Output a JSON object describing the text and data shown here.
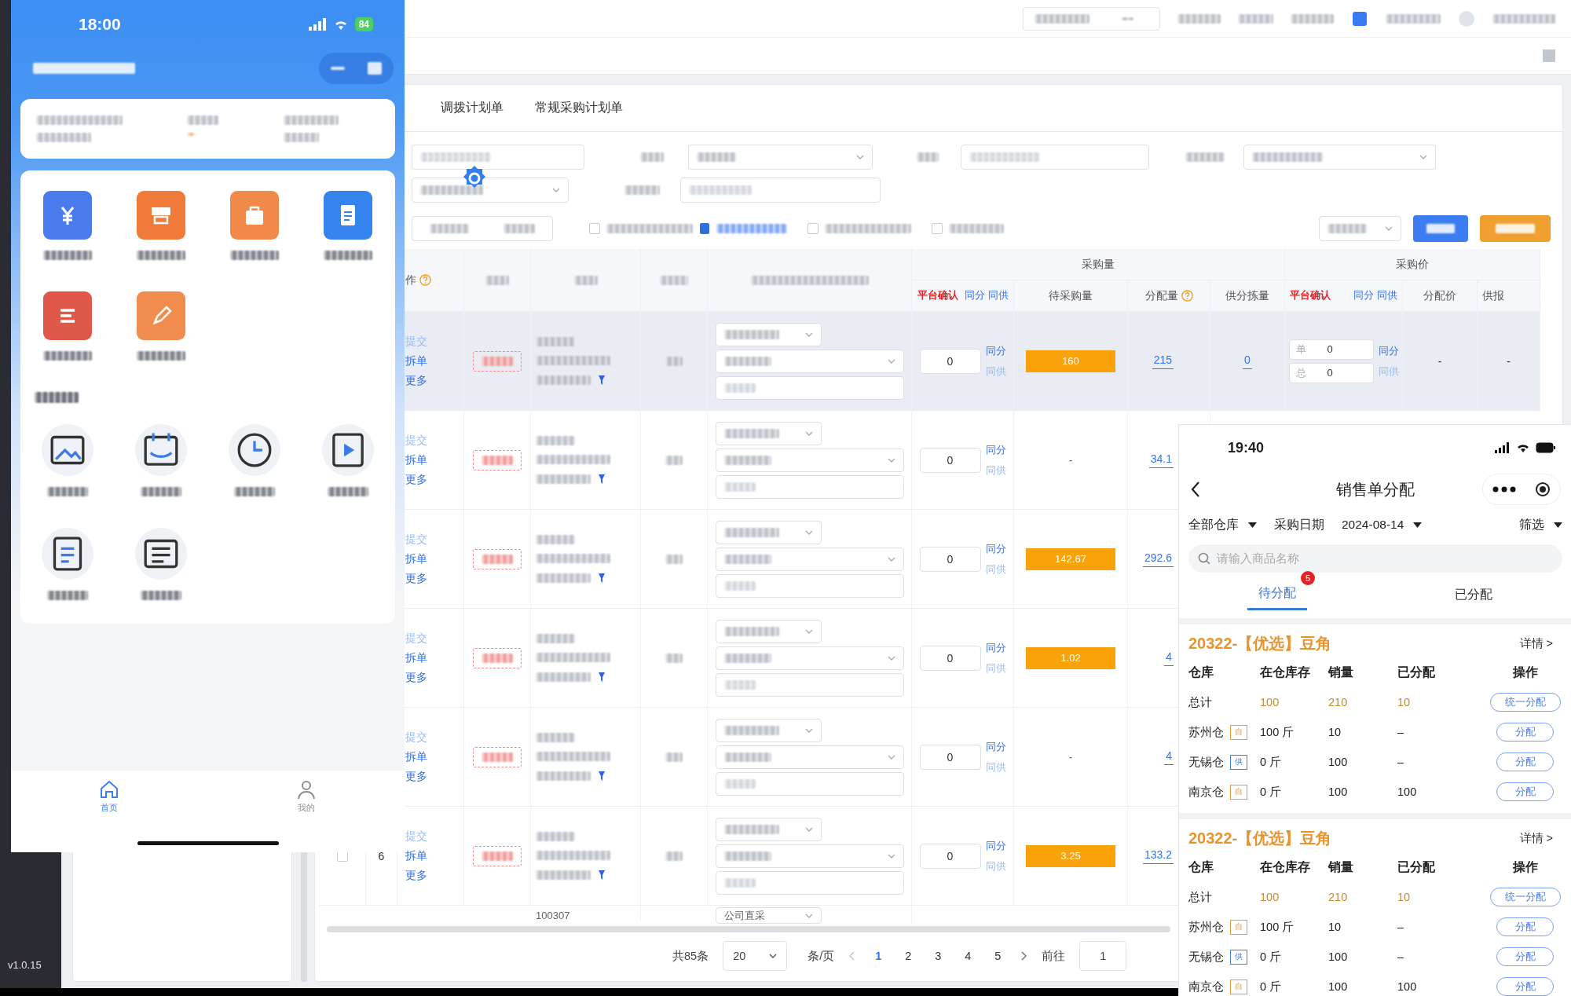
{
  "desktop_app": {
    "version": "v1.0.15",
    "tabs": [
      {
        "label": "调拨计划单"
      },
      {
        "label": "常规采购计划单"
      }
    ],
    "toolbar_checkboxes": [
      {
        "checked": false
      },
      {
        "checked": false
      },
      {
        "checked": false
      }
    ],
    "table": {
      "group_headers": [
        {
          "label": "采购量"
        },
        {
          "label": "采购价"
        }
      ],
      "headers": {
        "operations": "作",
        "qty_confirm": "平台确认",
        "qty_links": [
          "同分",
          "同供"
        ],
        "pending_qty": "待采购量",
        "allocated_qty": "分配量",
        "sorting_qty": "供分拣量",
        "price_confirm": "平台确认",
        "price_links": [
          "同分",
          "同供"
        ],
        "allocated_price": "分配价",
        "supplier_price": "供报"
      },
      "rows": [
        {
          "hovered": true,
          "actions": [
            {
              "label": "提交",
              "disabled": true
            },
            {
              "label": "拆单",
              "disabled": false
            },
            {
              "label": "更多",
              "disabled": false
            }
          ],
          "qty_input": "0",
          "links": [
            {
              "label": "同分",
              "disabled": false
            },
            {
              "label": "同供",
              "disabled": true
            }
          ],
          "pending_qty": "160",
          "pending_highlight": true,
          "allocated_qty": "215",
          "sorting_qty": "0",
          "price_inputs": [
            {
              "label": "单",
              "value": "0"
            },
            {
              "label": "总",
              "value": "0"
            }
          ],
          "price_links": [
            {
              "label": "同分",
              "disabled": false
            },
            {
              "label": "同供",
              "disabled": true
            }
          ],
          "allocated_price": "-",
          "supplier_price": "-"
        },
        {
          "hovered": false,
          "actions": [
            {
              "label": "提交",
              "disabled": true
            },
            {
              "label": "拆单",
              "disabled": false
            },
            {
              "label": "更多",
              "disabled": false
            }
          ],
          "qty_input": "0",
          "links": [
            {
              "label": "同分",
              "disabled": false
            },
            {
              "label": "同供",
              "disabled": true
            }
          ],
          "pending_qty": "-",
          "pending_highlight": false,
          "allocated_qty": "34.1"
        },
        {
          "hovered": false,
          "actions": [
            {
              "label": "提交",
              "disabled": true
            },
            {
              "label": "拆单",
              "disabled": false
            },
            {
              "label": "更多",
              "disabled": false
            }
          ],
          "qty_input": "0",
          "links": [
            {
              "label": "同分",
              "disabled": false
            },
            {
              "label": "同供",
              "disabled": true
            }
          ],
          "pending_qty": "142.67",
          "pending_highlight": true,
          "allocated_qty": "292.6"
        },
        {
          "hovered": false,
          "actions": [
            {
              "label": "提交",
              "disabled": true
            },
            {
              "label": "拆单",
              "disabled": false
            },
            {
              "label": "更多",
              "disabled": false
            }
          ],
          "qty_input": "0",
          "links": [
            {
              "label": "同分",
              "disabled": false
            },
            {
              "label": "同供",
              "disabled": true
            }
          ],
          "pending_qty": "1.02",
          "pending_highlight": true,
          "allocated_qty": "4"
        },
        {
          "hovered": false,
          "actions": [
            {
              "label": "提交",
              "disabled": true
            },
            {
              "label": "拆单",
              "disabled": false
            },
            {
              "label": "更多",
              "disabled": false
            }
          ],
          "qty_input": "0",
          "links": [
            {
              "label": "同分",
              "disabled": false
            },
            {
              "label": "同供",
              "disabled": true
            }
          ],
          "pending_qty": "-",
          "pending_highlight": false,
          "allocated_qty": "4"
        },
        {
          "hovered": false,
          "checked": false,
          "index": "6",
          "actions": [
            {
              "label": "提交",
              "disabled": true
            },
            {
              "label": "拆单",
              "disabled": false
            },
            {
              "label": "更多",
              "disabled": false
            }
          ],
          "qty_input": "0",
          "links": [
            {
              "label": "同分",
              "disabled": false
            },
            {
              "label": "同供",
              "disabled": true
            }
          ],
          "pending_qty": "3.25",
          "pending_highlight": true,
          "allocated_qty": "133.2"
        }
      ],
      "partial_row": {
        "product_code": "100307",
        "source": "公司直采"
      }
    },
    "pagination": {
      "total": "共85条",
      "page_size": "20",
      "per_page": "条/页",
      "pages": [
        {
          "label": "1",
          "selected": true
        },
        {
          "label": "2",
          "selected": false
        },
        {
          "label": "3",
          "selected": false
        },
        {
          "label": "4",
          "selected": false
        },
        {
          "label": "5",
          "selected": false
        }
      ],
      "goto": "前往",
      "goto_value": "1"
    }
  },
  "left_phone": {
    "status_time": "18:00",
    "battery": "84",
    "shortcuts": [
      {
        "kind": "yen",
        "color": "#4a7bec"
      },
      {
        "kind": "printer",
        "color": "#f07a3a"
      },
      {
        "kind": "bag",
        "color": "#f0894a"
      },
      {
        "kind": "doc",
        "color": "#3584ee"
      },
      {
        "kind": "lines",
        "color": "#e0584a"
      },
      {
        "kind": "pen",
        "color": "#f08c4e"
      }
    ],
    "tools": [
      {
        "kind": "image"
      },
      {
        "kind": "calendar"
      },
      {
        "kind": "clock"
      },
      {
        "kind": "video"
      },
      {
        "kind": "list"
      },
      {
        "kind": "form"
      }
    ],
    "tabs": [
      {
        "label": "首页",
        "kind": "home",
        "selected": true
      },
      {
        "label": "我的",
        "kind": "user",
        "selected": false
      }
    ]
  },
  "right_phone": {
    "status_time": "19:40",
    "title": "销售单分配",
    "filters": [
      {
        "label": "全部仓库",
        "dropdown": true
      },
      {
        "label": "采购日期",
        "dropdown": false
      },
      {
        "label": "2024-08-14",
        "dropdown": true
      }
    ],
    "filter_button": "筛选",
    "search_placeholder": "请输入商品名称",
    "tabs": [
      {
        "label": "待分配",
        "selected": true,
        "badge": "5"
      },
      {
        "label": "已分配",
        "selected": false
      }
    ],
    "products": [
      {
        "title": "20322-【优选】豆角",
        "detail_link": "详情 >",
        "columns": [
          "仓库",
          "在仓库存",
          "销量",
          "已分配",
          "操作"
        ],
        "total": {
          "label": "总计",
          "stock": "100",
          "sales": "210",
          "allocated": "10",
          "button": "统一分配"
        },
        "warehouses": [
          {
            "name": "苏州仓",
            "tag": "自",
            "kind": "own",
            "stock": "100 斤",
            "sales": "10",
            "allocated": "–",
            "button": "分配"
          },
          {
            "name": "无锡仓",
            "tag": "供",
            "kind": "supplier",
            "stock": "0 斤",
            "sales": "100",
            "allocated": "–",
            "button": "分配"
          },
          {
            "name": "南京仓",
            "tag": "自",
            "kind": "own",
            "stock": "0 斤",
            "sales": "100",
            "allocated": "100",
            "button": "分配"
          }
        ]
      },
      {
        "title": "20322-【优选】豆角",
        "detail_link": "详情 >",
        "columns": [
          "仓库",
          "在仓库存",
          "销量",
          "已分配",
          "操作"
        ],
        "total": {
          "label": "总计",
          "stock": "100",
          "sales": "210",
          "allocated": "10",
          "button": "统一分配"
        },
        "warehouses": [
          {
            "name": "苏州仓",
            "tag": "自",
            "kind": "own",
            "stock": "100 斤",
            "sales": "10",
            "allocated": "–",
            "button": "分配"
          },
          {
            "name": "无锡仓",
            "tag": "供",
            "kind": "supplier",
            "stock": "0 斤",
            "sales": "100",
            "allocated": "–",
            "button": "分配"
          },
          {
            "name": "南京仓",
            "tag": "自",
            "kind": "own",
            "stock": "0 斤",
            "sales": "100",
            "allocated": "100",
            "button": "分配"
          }
        ]
      }
    ]
  }
}
